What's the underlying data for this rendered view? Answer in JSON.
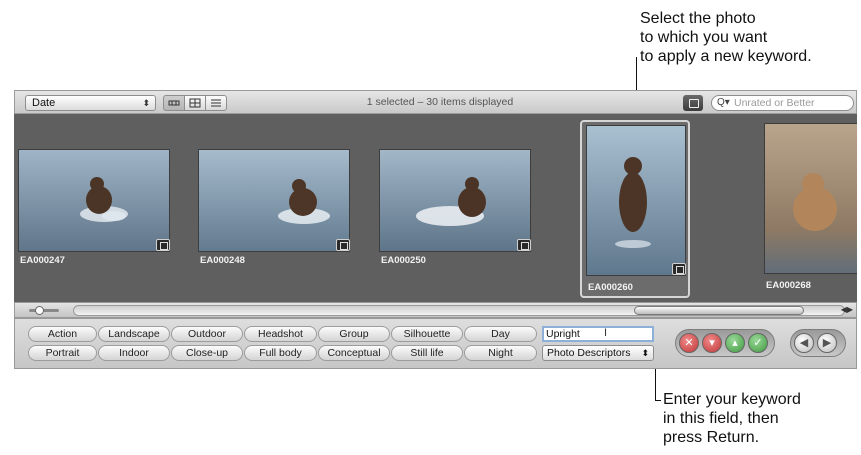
{
  "callouts": {
    "top": "Select the photo\nto which you want\nto apply a new keyword.",
    "bottom": "Enter your keyword\nin this field, then\npress Return."
  },
  "toolbar": {
    "sort_value": "Date",
    "view_buttons": [
      "filmstrip-view-icon",
      "grid-view-icon",
      "list-view-icon"
    ],
    "status": "1 selected – 30 items displayed",
    "search_placeholder": "Unrated or Better"
  },
  "thumbnails": [
    {
      "label": "EA000247",
      "selected": false
    },
    {
      "label": "EA000248",
      "selected": false
    },
    {
      "label": "EA000250",
      "selected": false
    },
    {
      "label": "EA000260",
      "selected": true
    },
    {
      "label": "EA000268",
      "selected": false
    }
  ],
  "keyword_buttons": {
    "row1": [
      "Action",
      "Landscape",
      "Outdoor",
      "Headshot",
      "Group",
      "Silhouette",
      "Day"
    ],
    "row2": [
      "Portrait",
      "Indoor",
      "Close-up",
      "Full body",
      "Conceptual",
      "Still life",
      "Night"
    ]
  },
  "keyword_input": "Upright",
  "keyword_set": "Photo Descriptors",
  "rating_buttons": [
    "reject-icon",
    "decrease-rating-icon",
    "increase-rating-icon",
    "select-icon"
  ],
  "nav_buttons": [
    "previous-icon",
    "next-icon"
  ],
  "colors": {
    "browser_bg": "#5f5f5f",
    "reject": "#d94a4a",
    "increase": "#4aa84a",
    "input_focus": "#8db0d8"
  }
}
